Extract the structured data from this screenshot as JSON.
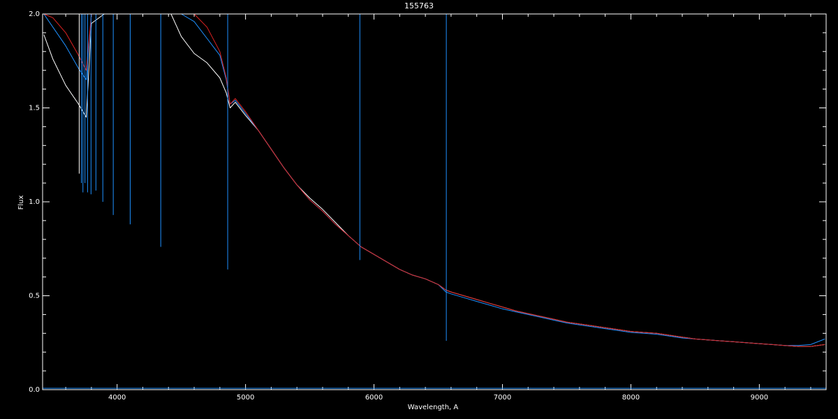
{
  "chart_data": {
    "type": "line",
    "title": "155763",
    "xlabel": "Wavelength, A",
    "ylabel": "Flux",
    "xlim": [
      3420,
      9520
    ],
    "ylim": [
      0.0,
      2.0
    ],
    "x_ticks": [
      {
        "value": 4000,
        "label": "4000"
      },
      {
        "value": 5000,
        "label": "5000"
      },
      {
        "value": 6000,
        "label": "6000"
      },
      {
        "value": 7000,
        "label": "7000"
      },
      {
        "value": 8000,
        "label": "8000"
      },
      {
        "value": 9000,
        "label": "9000"
      }
    ],
    "y_ticks": [
      {
        "value": 0.0,
        "label": "0.0"
      },
      {
        "value": 0.5,
        "label": "0.5"
      },
      {
        "value": 1.0,
        "label": "1.0"
      },
      {
        "value": 1.5,
        "label": "1.5"
      },
      {
        "value": 2.0,
        "label": "2.0"
      }
    ],
    "grid": false,
    "legend": "none",
    "series": [
      {
        "color": "#ffffff",
        "x": [
          3430,
          3500,
          3600,
          3700,
          3760,
          3800,
          3900,
          4000,
          4100,
          4200,
          4300,
          4420,
          4500,
          4600,
          4700,
          4800,
          4850,
          4880,
          4920,
          5000,
          5100,
          5200,
          5300,
          5400,
          5500,
          5600,
          5700,
          5800,
          5900,
          6000,
          6100,
          6200,
          6300,
          6400,
          6500,
          6560,
          6600,
          6700,
          6800,
          6900,
          7000,
          7100,
          7200,
          7300,
          7400,
          7500,
          7600,
          7700,
          7800,
          7900,
          8000,
          8100,
          8200,
          8300,
          8400,
          8500,
          8600,
          8700,
          8800,
          8900,
          9000,
          9100,
          9200,
          9300,
          9400,
          9510
        ],
        "y": [
          1.89,
          1.76,
          1.62,
          1.52,
          1.45,
          1.95,
          2.0,
          2.0,
          2.0,
          2.0,
          2.0,
          2.0,
          1.88,
          1.79,
          1.74,
          1.66,
          1.58,
          1.5,
          1.53,
          1.46,
          1.38,
          1.28,
          1.18,
          1.09,
          1.02,
          0.96,
          0.89,
          0.82,
          0.76,
          0.72,
          0.68,
          0.64,
          0.61,
          0.59,
          0.56,
          0.53,
          0.52,
          0.5,
          0.48,
          0.46,
          0.44,
          0.42,
          0.405,
          0.39,
          0.375,
          0.36,
          0.35,
          0.34,
          0.33,
          0.32,
          0.31,
          0.305,
          0.3,
          0.29,
          0.28,
          0.27,
          0.265,
          0.26,
          0.255,
          0.25,
          0.245,
          0.24,
          0.235,
          0.23,
          0.23,
          0.24
        ]
      },
      {
        "color": "#1e90ff",
        "x": [
          3430,
          3500,
          3600,
          3700,
          3760,
          3800,
          3900,
          4000,
          4100,
          4200,
          4300,
          4420,
          4500,
          4600,
          4700,
          4800,
          4850,
          4880,
          4920,
          5000,
          5100,
          5200,
          5300,
          5400,
          5500,
          5600,
          5700,
          5800,
          5900,
          6000,
          6100,
          6200,
          6300,
          6400,
          6500,
          6560,
          6600,
          6700,
          6800,
          6900,
          7000,
          7100,
          7200,
          7300,
          7400,
          7500,
          7600,
          7700,
          7800,
          7900,
          8000,
          8100,
          8200,
          8300,
          8400,
          8500,
          8600,
          8700,
          8800,
          8900,
          9000,
          9100,
          9200,
          9300,
          9400,
          9510
        ],
        "y": [
          2.0,
          1.93,
          1.83,
          1.71,
          1.65,
          2.0,
          2.0,
          2.0,
          2.0,
          2.0,
          2.0,
          2.0,
          2.0,
          1.96,
          1.87,
          1.78,
          1.65,
          1.52,
          1.54,
          1.47,
          1.38,
          1.28,
          1.18,
          1.09,
          1.01,
          0.95,
          0.88,
          0.82,
          0.76,
          0.72,
          0.68,
          0.64,
          0.61,
          0.59,
          0.56,
          0.52,
          0.51,
          0.49,
          0.47,
          0.45,
          0.43,
          0.415,
          0.4,
          0.385,
          0.37,
          0.355,
          0.345,
          0.335,
          0.325,
          0.315,
          0.305,
          0.3,
          0.295,
          0.285,
          0.275,
          0.27,
          0.265,
          0.26,
          0.255,
          0.25,
          0.245,
          0.24,
          0.235,
          0.235,
          0.24,
          0.27
        ]
      },
      {
        "color": "#dd2222",
        "x": [
          3430,
          3500,
          3600,
          3700,
          3760,
          3800,
          3900,
          4000,
          4100,
          4200,
          4300,
          4420,
          4500,
          4600,
          4700,
          4800,
          4850,
          4880,
          4920,
          5000,
          5100,
          5200,
          5300,
          5400,
          5500,
          5600,
          5700,
          5800,
          5900,
          6000,
          6100,
          6200,
          6300,
          6400,
          6500,
          6560,
          6600,
          6700,
          6800,
          6900,
          7000,
          7100,
          7200,
          7300,
          7400,
          7500,
          7600,
          7700,
          7800,
          7900,
          8000,
          8100,
          8200,
          8300,
          8400,
          8500,
          8600,
          8700,
          8800,
          8900,
          9000,
          9100,
          9200,
          9300,
          9400,
          9510
        ],
        "y": [
          2.0,
          1.98,
          1.9,
          1.78,
          1.7,
          2.0,
          2.0,
          2.0,
          2.0,
          2.0,
          2.0,
          2.0,
          2.0,
          2.0,
          1.93,
          1.8,
          1.66,
          1.52,
          1.55,
          1.48,
          1.38,
          1.28,
          1.18,
          1.09,
          1.01,
          0.95,
          0.88,
          0.82,
          0.76,
          0.72,
          0.68,
          0.64,
          0.61,
          0.59,
          0.56,
          0.53,
          0.52,
          0.5,
          0.48,
          0.46,
          0.44,
          0.42,
          0.405,
          0.39,
          0.375,
          0.36,
          0.35,
          0.34,
          0.33,
          0.32,
          0.31,
          0.305,
          0.3,
          0.29,
          0.28,
          0.27,
          0.265,
          0.26,
          0.255,
          0.25,
          0.245,
          0.24,
          0.235,
          0.23,
          0.23,
          0.24
        ]
      }
    ],
    "absorption_lines": [
      {
        "x": 3705,
        "y_min": 1.15,
        "color": "#ffffff"
      },
      {
        "x": 3722,
        "y_min": 1.1,
        "color": "#1e90ff"
      },
      {
        "x": 3734,
        "y_min": 1.05,
        "color": "#1e90ff"
      },
      {
        "x": 3750,
        "y_min": 1.1,
        "color": "#1e90ff"
      },
      {
        "x": 3770,
        "y_min": 1.05,
        "color": "#1e90ff"
      },
      {
        "x": 3797,
        "y_min": 1.04,
        "color": "#1e90ff"
      },
      {
        "x": 3835,
        "y_min": 1.06,
        "color": "#1e90ff"
      },
      {
        "x": 3889,
        "y_min": 1.0,
        "color": "#1e90ff"
      },
      {
        "x": 3970,
        "y_min": 0.93,
        "color": "#1e90ff"
      },
      {
        "x": 4102,
        "y_min": 0.88,
        "color": "#1e90ff"
      },
      {
        "x": 4340,
        "y_min": 0.76,
        "color": "#1e90ff"
      },
      {
        "x": 4861,
        "y_min": 0.64,
        "color": "#1e90ff"
      },
      {
        "x": 5890,
        "y_min": 0.69,
        "color": "#1e90ff"
      },
      {
        "x": 6563,
        "y_min": 0.26,
        "color": "#1e90ff"
      }
    ]
  }
}
